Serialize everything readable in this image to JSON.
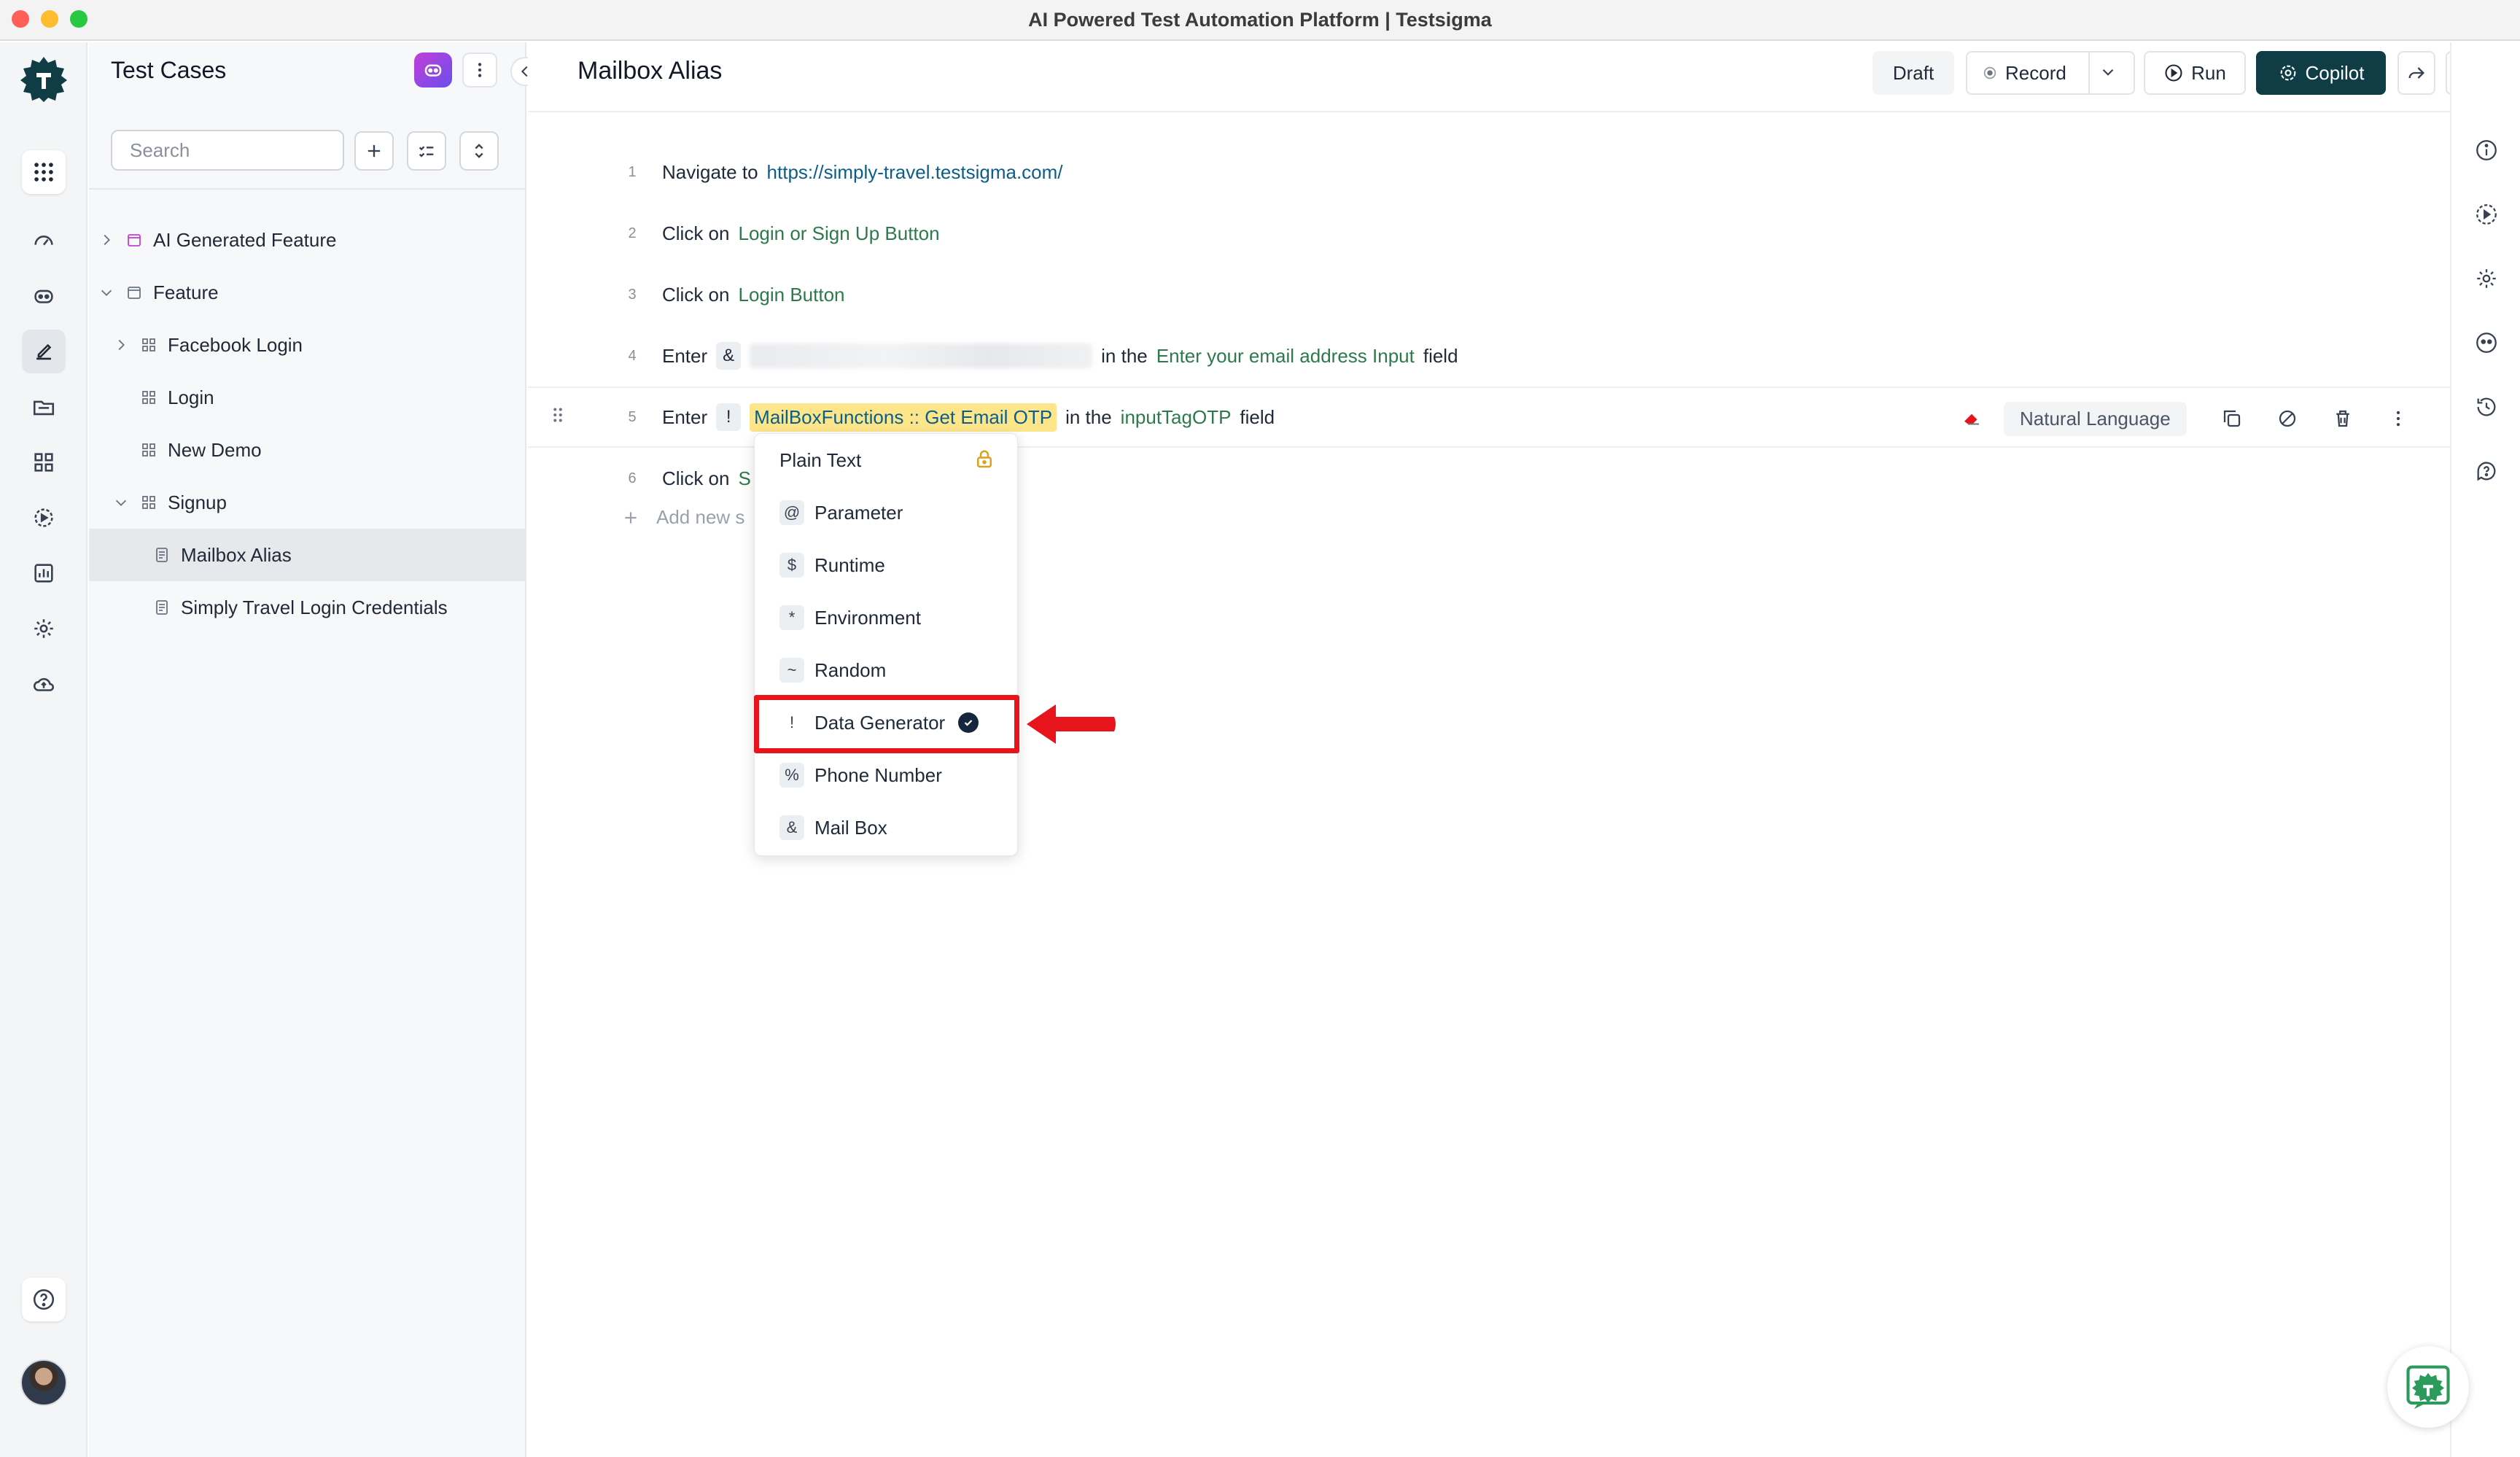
{
  "window": {
    "title": "AI Powered Test Automation Platform | Testsigma"
  },
  "tree": {
    "title": "Test Cases",
    "search_placeholder": "Search",
    "nodes": [
      {
        "label": "AI Generated Feature",
        "expanded": false
      },
      {
        "label": "Feature",
        "expanded": true
      },
      {
        "label": "Facebook Login",
        "expanded": false
      },
      {
        "label": "Login"
      },
      {
        "label": "New Demo"
      },
      {
        "label": "Signup",
        "expanded": true
      },
      {
        "label": "Mailbox Alias",
        "selected": true
      },
      {
        "label": "Simply Travel Login Credentials"
      }
    ]
  },
  "header": {
    "title": "Mailbox Alias",
    "draft": "Draft",
    "record": "Record",
    "run": "Run",
    "copilot": "Copilot"
  },
  "steps": [
    {
      "num": "1",
      "verb": "Navigate to",
      "url": "https://simply-travel.testsigma.com/"
    },
    {
      "num": "2",
      "verb": "Click on",
      "element": "Login or Sign Up Button"
    },
    {
      "num": "3",
      "verb": "Click on",
      "element": "Login Button"
    },
    {
      "num": "4",
      "verb": "Enter",
      "chip": "&",
      "mid": "in the",
      "element": "Enter your email address Input",
      "tail": "field"
    },
    {
      "num": "5",
      "verb": "Enter",
      "chip": "!",
      "value": "MailBoxFunctions :: Get Email OTP",
      "mid": "in the",
      "element": "inputTagOTP",
      "tail": "field",
      "mode": "Natural Language"
    },
    {
      "num": "6",
      "verb": "Click on",
      "element_partial": "S"
    }
  ],
  "add_new": "Add new s",
  "dropdown": {
    "plain_text": "Plain Text",
    "items": [
      {
        "symbol": "@",
        "label": "Parameter"
      },
      {
        "symbol": "$",
        "label": "Runtime"
      },
      {
        "symbol": "*",
        "label": "Environment"
      },
      {
        "symbol": "~",
        "label": "Random"
      },
      {
        "symbol": "!",
        "label": "Data Generator",
        "selected": true
      },
      {
        "symbol": "%",
        "label": "Phone Number"
      },
      {
        "symbol": "&",
        "label": "Mail Box"
      }
    ]
  },
  "colors": {
    "accent_dark": "#0f3c45",
    "highlight": "#fde68a",
    "annotation_red": "#e8141c",
    "element_green": "#2c7a4b",
    "link_blue": "#0b5e8a"
  }
}
